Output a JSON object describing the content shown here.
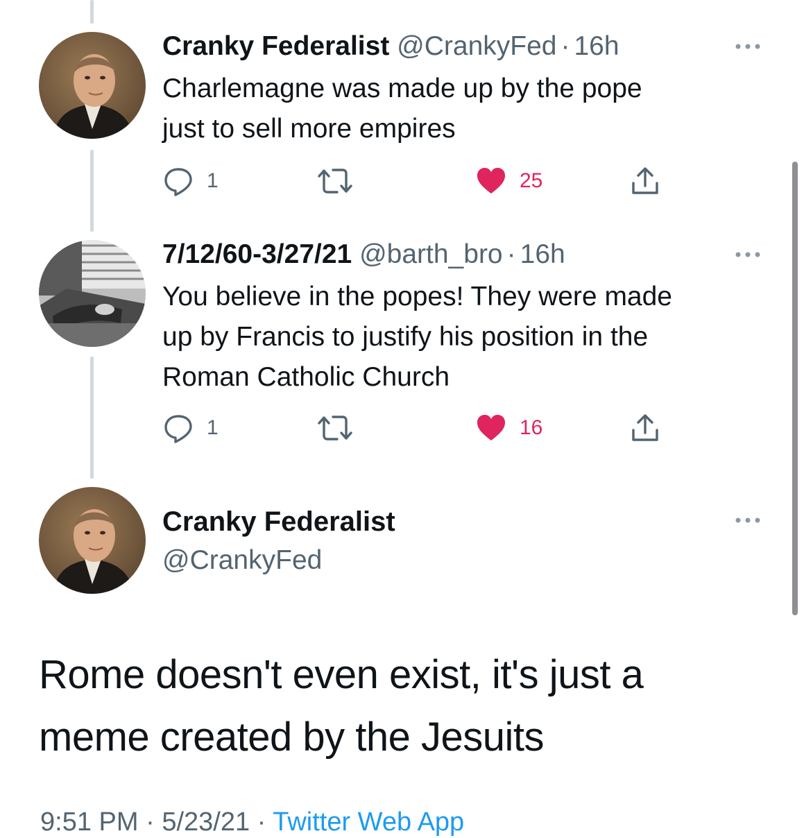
{
  "tweets": [
    {
      "name": "Cranky Federalist",
      "handle": "@CrankyFed",
      "separator": "·",
      "time": "16h",
      "text_lines": [
        "Charlemagne was made up by the pope",
        "just to sell more empires"
      ],
      "replies": "1",
      "likes": "25",
      "avatar_icon": "portrait-avatar",
      "liked": true
    },
    {
      "name": "7/12/60-3/27/21",
      "handle": "@barth_bro",
      "separator": "·",
      "time": "16h",
      "text_lines": [
        "You believe in the popes! They were made",
        "up by Francis to justify his position in the",
        "Roman Catholic Church"
      ],
      "replies": "1",
      "likes": "16",
      "avatar_icon": "bw-photo-avatar",
      "liked": true
    }
  ],
  "main_tweet": {
    "name": "Cranky Federalist",
    "handle": "@CrankyFed",
    "text_lines": [
      "Rome doesn't even exist, it's just a",
      "meme created by the Jesuits"
    ],
    "time": "9:51 PM",
    "separator": "·",
    "date": "5/23/21",
    "app": "Twitter Web App"
  },
  "colors": {
    "like": "#e0245e",
    "secondary_text": "#536471",
    "link": "#1d9bf0",
    "thread_line": "#cfd9de"
  }
}
